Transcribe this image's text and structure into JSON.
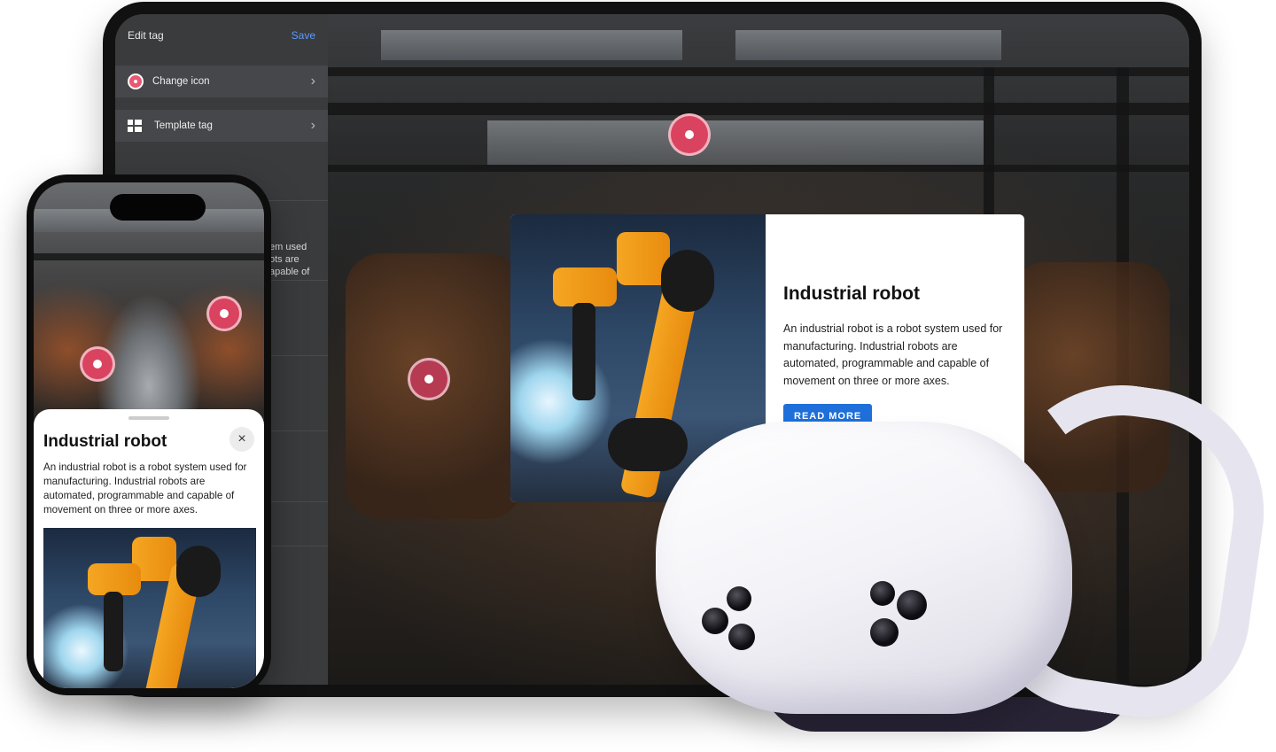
{
  "editor": {
    "title": "Edit tag",
    "save_label": "Save",
    "rows": [
      {
        "label": "Change icon",
        "icon": "hotspot-icon"
      },
      {
        "label": "Template tag",
        "icon": "template-icon"
      }
    ],
    "ghost_text_lines": [
      "em used",
      "ots are",
      "apable of"
    ]
  },
  "tablet_card": {
    "title": "Industrial robot",
    "text": "An industrial robot is a robot system used for manufacturing. Industrial robots are automated, programmable and capable of movement on three or more axes.",
    "button_label": "READ MORE"
  },
  "phone_sheet": {
    "title": "Industrial robot",
    "close_icon": "×",
    "text": "An industrial robot is a robot system used for manufacturing. Industrial robots are automated, programmable and capable of movement on three or more axes."
  },
  "colors": {
    "hotspot": "#d9435f",
    "accent_blue": "#1e6fd9",
    "save_blue": "#5a9bff",
    "robot_orange": "#f5a623"
  }
}
